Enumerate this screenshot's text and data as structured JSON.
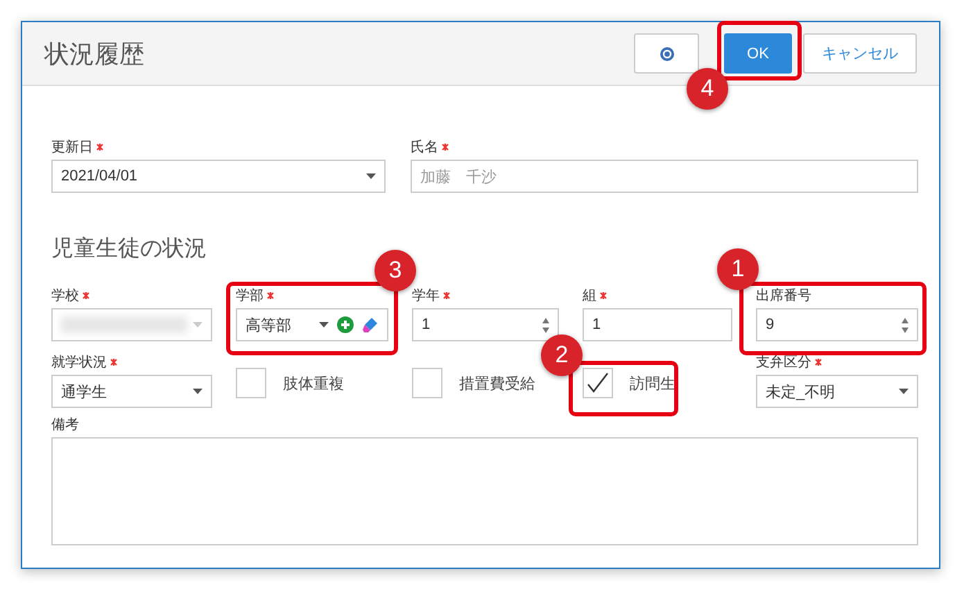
{
  "dialog": {
    "title": "状況履歴",
    "buttons": [
      {
        "kind": "help"
      },
      {
        "kind": "primary",
        "label": "OK"
      },
      {
        "kind": "secondary",
        "label": "キャンセル"
      }
    ]
  },
  "top_fields": [
    {
      "kind": "select",
      "label": "更新日",
      "required": true,
      "value": "2021/04/01"
    },
    {
      "kind": "text",
      "label": "氏名",
      "required": true,
      "placeholder": "加藤　千沙"
    }
  ],
  "section_title": "児童生徒の状況",
  "fields": [
    {
      "kind": "blurred",
      "label": "学校",
      "required": true
    },
    {
      "kind": "select-actions",
      "label": "学部",
      "required": true,
      "value": "高等部"
    },
    {
      "kind": "number",
      "label": "学年",
      "required": true,
      "value": "1"
    },
    {
      "kind": "text",
      "label": "組",
      "required": true,
      "value": "1"
    },
    {
      "kind": "number",
      "label": "出席番号",
      "required": false,
      "value": "9"
    },
    {
      "kind": "select",
      "label": "就学状況",
      "required": true,
      "value": "通学生"
    },
    {
      "kind": "checkbox",
      "label": "肢体重複",
      "checked": false
    },
    {
      "kind": "checkbox",
      "label": "措置費受給",
      "checked": false
    },
    {
      "kind": "checkbox",
      "label": "訪問生",
      "checked": true
    },
    {
      "kind": "select",
      "label": "支弁区分",
      "required": true,
      "value": "未定_不明"
    }
  ],
  "remarks": {
    "label": "備考"
  },
  "callouts": [
    {
      "number": "1"
    },
    {
      "number": "2"
    },
    {
      "number": "3"
    },
    {
      "number": "4"
    }
  ]
}
